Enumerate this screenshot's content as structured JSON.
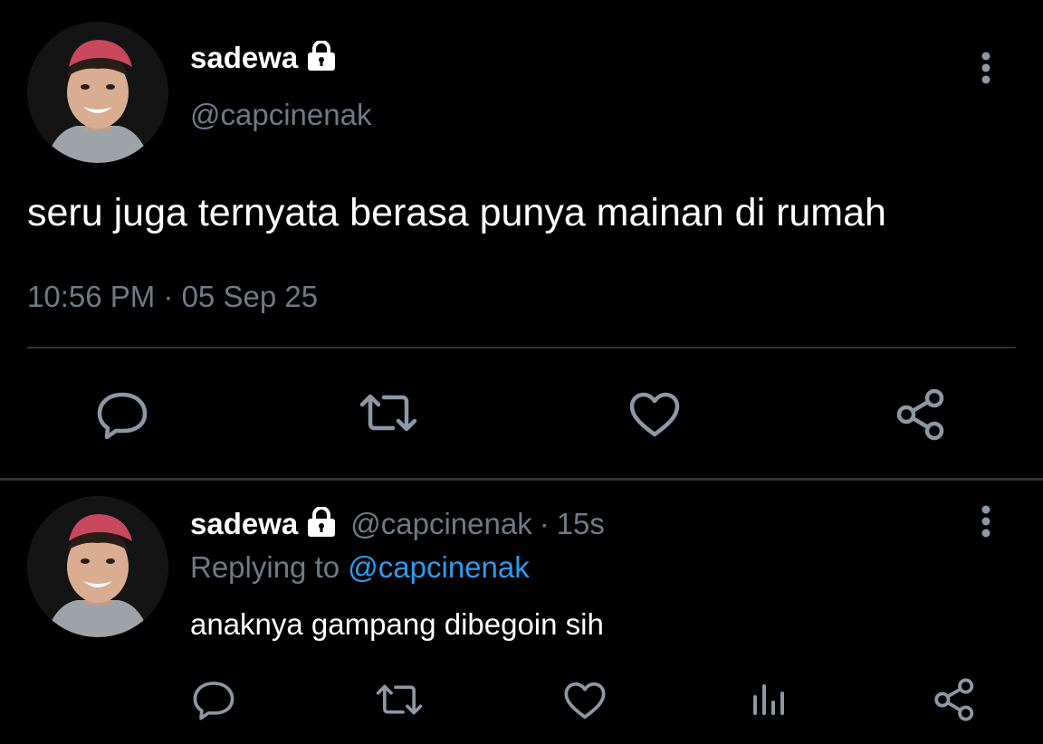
{
  "main_tweet": {
    "display_name": "sadewa",
    "handle": "@capcinenak",
    "text": "seru juga ternyata berasa punya mainan di rumah",
    "timestamp": "10:56 PM · 05 Sep 25",
    "actions": [
      "reply-icon",
      "retweet-icon",
      "like-icon",
      "share-icon"
    ],
    "menu_icon": "more-vertical-icon"
  },
  "reply_tweet": {
    "display_name": "sadewa",
    "handle": "@capcinenak",
    "separator": "·",
    "time_ago": "15s",
    "replying_prefix": "Replying to",
    "replying_handle": "@capcinenak",
    "text": "anaknya gampang dibegoin sih",
    "actions": [
      "reply-icon",
      "retweet-icon",
      "like-icon",
      "analytics-icon",
      "share-icon"
    ],
    "menu_icon": "more-vertical-icon"
  },
  "colors": {
    "background": "#000000",
    "muted_text": "#6e7a87",
    "link": "#2b9cf0",
    "icon": "#8b98a5",
    "divider": "#2f3336"
  }
}
